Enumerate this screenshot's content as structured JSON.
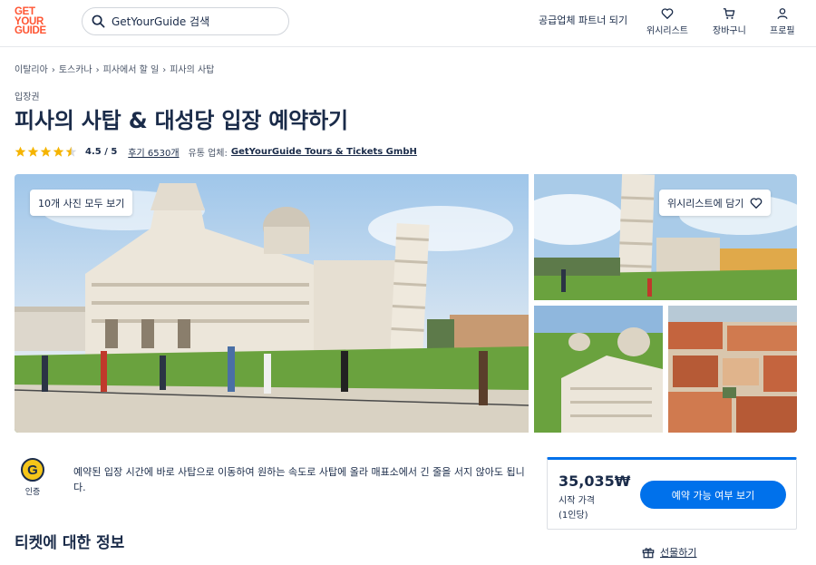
{
  "header": {
    "logo": [
      "GET",
      "YOUR",
      "GUIDE"
    ],
    "search_placeholder": "GetYourGuide 검색",
    "supplier_link": "공급업체 파트너 되기",
    "wishlist": "위시리스트",
    "cart": "장바구니",
    "profile": "프로필"
  },
  "breadcrumb": [
    "이탈리아",
    "토스카나",
    "피사에서 할 일",
    "피사의 사탑"
  ],
  "product": {
    "category": "입장권",
    "title": "피사의 사탑 & 대성당 입장 예약하기",
    "rating": "4.5 / 5",
    "rating_value": 4.5,
    "reviews": "후기 6530개",
    "provider_label": "유통 업체:",
    "provider": "GetYourGuide Tours & Tickets GmbH"
  },
  "gallery": {
    "all_photos": "10개 사진 모두 보기",
    "add_wishlist": "위시리스트에 담기"
  },
  "badge": {
    "letter": "G",
    "label": "인증"
  },
  "highlight": "예약된 입장 시간에 바로 사탑으로 이동하여 원하는 속도로 사탑에 올라 매표소에서 긴 줄을 서지 않아도 됩니다.",
  "section_title": "티켓에 대한 정보",
  "booking": {
    "price": "35,035₩",
    "from_label": "시작 가격",
    "per_person": "(1인당)",
    "check_button": "예약 가능 여부 보기"
  },
  "gift": "선물하기",
  "colors": {
    "brand": "#ff5533",
    "primary": "#0071eb",
    "text": "#1a2b49",
    "star": "#f5b400"
  }
}
